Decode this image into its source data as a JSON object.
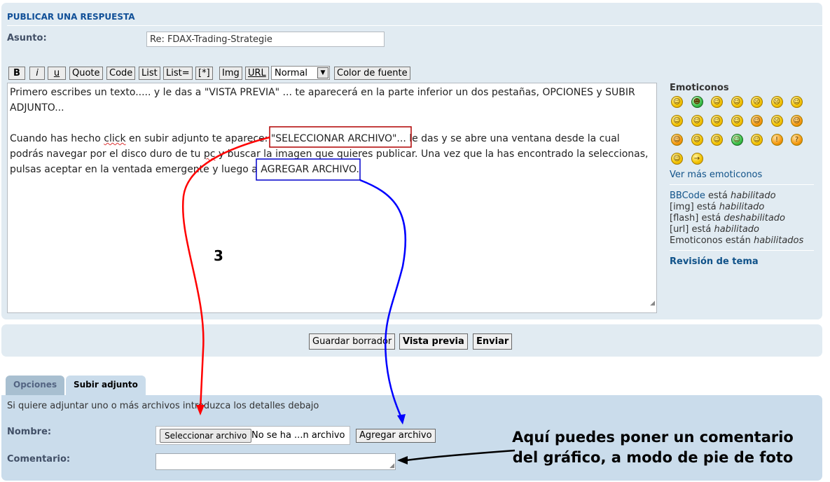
{
  "header": {
    "title": "PUBLICAR UNA RESPUESTA"
  },
  "subject": {
    "label": "Asunto:",
    "value": "Re: FDAX-Trading-Strategie"
  },
  "toolbar": {
    "buttons": [
      "B",
      "i",
      "u",
      "Quote",
      "Code",
      "List",
      "List=",
      "[*]",
      "Img",
      "URL"
    ],
    "size_select": "Normal",
    "color_button": "Color de fuente"
  },
  "editor": {
    "para1_line1": "Primero escribes un texto..... y le das a \"VISTA PREVIA\" ... te aparecerá en la parte inferior un dos pestañas, OPCIONES y SUBIR",
    "para1_line2": "ADJUNTO...",
    "para2_line1_a": "Cuando has hecho ",
    "para2_line1_click": "click",
    "para2_line1_b": " en subir adjunto te aparece: \"SELECCIONAR ARCHIVO\"... le das y se abre una ventana desde la cual",
    "para2_line2_a": "podrás navegar por el disco duro de tu ",
    "para2_line2_pc": "pc",
    "para2_line2_b": " y buscar la imagen que quieres publicar. Una vez que la has encontrado la seleccionas,",
    "para2_line3": "pulsas aceptar en la ventada emergente y luego a AGREGAR ARCHIVO."
  },
  "sidebar": {
    "emoticons_title": "Emoticonos",
    "more_emoticons": "Ver más emoticonos",
    "bbcode_link": "BBCode",
    "bbcode_rest": " está ",
    "bbcode_state": "habilitado",
    "img_text": "[img] está ",
    "img_state": "habilitado",
    "flash_text": "[flash] está ",
    "flash_state": "deshabilitado",
    "url_text": "[url] está ",
    "url_state": "habilitado",
    "emot_text": "Emoticonos están ",
    "emot_state": "habilitados",
    "topic_review": "Revisión de tema"
  },
  "actions": {
    "save_draft": "Guardar borrador",
    "preview": "Vista previa",
    "submit": "Enviar"
  },
  "tabs": [
    {
      "label": "Opciones"
    },
    {
      "label": "Subir adjunto"
    }
  ],
  "attachment": {
    "info": "Si quiere adjuntar uno o más archivos introduzca los detalles debajo",
    "name_label": "Nombre:",
    "choose_file": "Seleccionar archivo",
    "file_status": "No se ha ...n archivo",
    "add_file": "Agregar archivo",
    "comment_label": "Comentario:"
  },
  "annotations": {
    "step_number": "3",
    "note_line1": "Aquí puedes poner un comentario",
    "note_line2": "del gráfico, a modo de pie de foto",
    "colors": {
      "red": "#ff0000",
      "blue": "#0000ff",
      "black": "#000000"
    }
  }
}
